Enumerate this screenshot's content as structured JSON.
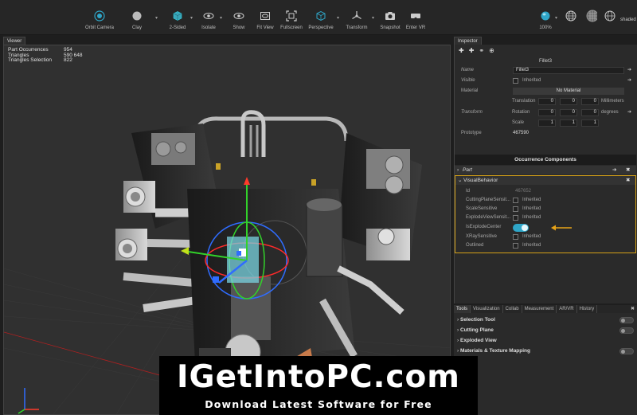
{
  "toolbar": {
    "orbit_camera": "Orbit Camera",
    "clay": "Clay",
    "two_sided": "2-Sided",
    "isolate": "Isolate",
    "show": "Show",
    "fit_view": "Fit View",
    "fullscreen": "Fullscreen",
    "perspective": "Perspective",
    "transform": "Transform",
    "snapshot": "Snapshot",
    "enter_vr": "Enter VR",
    "zoom": "100%",
    "shaded": "shaded"
  },
  "viewer": {
    "tab": "Viewer",
    "stats": [
      {
        "label": "Part Occurrences",
        "value": "954"
      },
      {
        "label": "Triangles",
        "value": "590 648"
      },
      {
        "label": "Triangles Selection",
        "value": "822"
      }
    ]
  },
  "inspector": {
    "tab": "Inspector",
    "object_title": "Fillet3",
    "name_label": "Name",
    "name_value": "Fillet3",
    "visible_label": "Visible",
    "inherited": "Inherited",
    "material_label": "Material",
    "material_value": "No Material",
    "transform_label": "Transform",
    "translation_label": "Translation",
    "translation": [
      "0",
      "0",
      "0"
    ],
    "translation_unit": "Millimeters",
    "rotation_label": "Rotation",
    "rotation": [
      "0",
      "0",
      "0"
    ],
    "rotation_unit": "degrees",
    "scale_label": "Scale",
    "scale": [
      "1",
      "1",
      "1"
    ],
    "prototype_label": "Prototype",
    "prototype_value": "467590",
    "occurrence_components": "Occurrence Components",
    "part_section": "Part",
    "visual_behavior_section": "VisualBehavior",
    "id_label": "Id",
    "id_value": "467652",
    "cutting_plane_label": "CuttingPlaneSensit...",
    "scale_sensitive_label": "ScaleSensitive",
    "explode_view_label": "ExplodeViewSensit...",
    "is_explode_center_label": "IsExplodeCenter",
    "xray_label": "XRaySensitive",
    "outlined_label": "Outlined"
  },
  "bottom_tabs": [
    "Tools",
    "Visualization",
    "Collab",
    "Measurement",
    "AR/VR",
    "History"
  ],
  "tools": [
    {
      "label": "Selection Tool"
    },
    {
      "label": "Cutting Plane"
    },
    {
      "label": "Exploded View"
    },
    {
      "label": "Materials & Texture Mapping"
    }
  ],
  "banner": {
    "main": "IGetIntoPC.com",
    "sub": "Download Latest Software for Free"
  },
  "colors": {
    "accent": "#2fa6c8",
    "highlight_border": "#d4a017",
    "arrow": "#e8a317"
  }
}
